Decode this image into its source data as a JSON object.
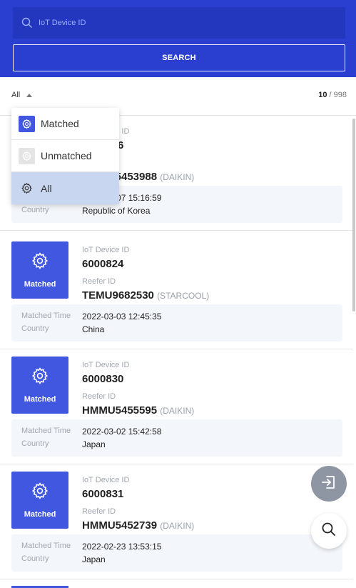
{
  "search": {
    "placeholder": "IoT Device ID",
    "button_label": "SEARCH"
  },
  "filter": {
    "selected": "All",
    "count_shown": "10",
    "count_sep": " / ",
    "count_total": "998",
    "options": [
      {
        "label": "Matched",
        "icon": "gear-icon"
      },
      {
        "label": "Unmatched",
        "icon": "gear-icon"
      },
      {
        "label": "All",
        "icon": "gear-icon"
      }
    ]
  },
  "labels": {
    "iot_device_id": "IoT Device ID",
    "reefer_id": "Reefer ID",
    "matched_time": "Matched Time",
    "country": "Country",
    "badge": "Matched"
  },
  "cards": [
    {
      "device_id": "6000826",
      "reefer_id": "HMMU5453988",
      "maker": "(DAIKIN)",
      "matched_time": "2022-03-07 15:16:59",
      "country": "Republic of Korea"
    },
    {
      "device_id": "6000824",
      "reefer_id": "TEMU9682530",
      "maker": "(STARCOOL)",
      "matched_time": "2022-03-03 12:45:35",
      "country": "China"
    },
    {
      "device_id": "6000830",
      "reefer_id": "HMMU5455595",
      "maker": "(DAIKIN)",
      "matched_time": "2022-03-02 15:42:58",
      "country": "Japan"
    },
    {
      "device_id": "6000831",
      "reefer_id": "HMMU5452739",
      "maker": "(DAIKIN)",
      "matched_time": "2022-02-23 13:53:15",
      "country": "Japan"
    }
  ],
  "colors": {
    "primary": "#2a3fd0",
    "badge": "#4157df",
    "selected_row": "#c9d6ef"
  },
  "icons": {
    "search": "search-icon",
    "exit": "exit-icon",
    "badge": "gear-icon"
  }
}
